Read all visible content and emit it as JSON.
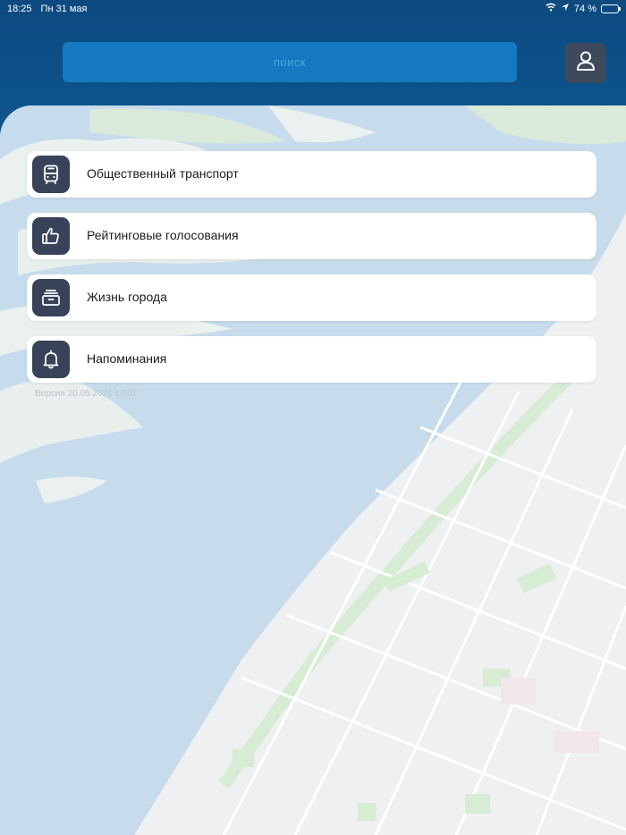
{
  "status": {
    "time": "18:25",
    "date": "Пн 31 мая",
    "battery": "74 %",
    "battery_level": 0.74
  },
  "search": {
    "placeholder": "поиск"
  },
  "menu": [
    {
      "label": "Общественный транспорт",
      "icon": "bus-icon"
    },
    {
      "label": "Рейтинговые голосования",
      "icon": "thumbs-up-icon"
    },
    {
      "label": "Жизнь города",
      "icon": "archive-box-icon"
    },
    {
      "label": "Напоминания",
      "icon": "bell-icon"
    }
  ],
  "version": "Версия 20.05.2021 12:07",
  "colors": {
    "header": "#0c4a80",
    "search_field": "#1479c0",
    "icon_tile": "#384359",
    "water": "#bfd9ec",
    "land": "#eef0f1",
    "park": "#d6ecd3"
  }
}
